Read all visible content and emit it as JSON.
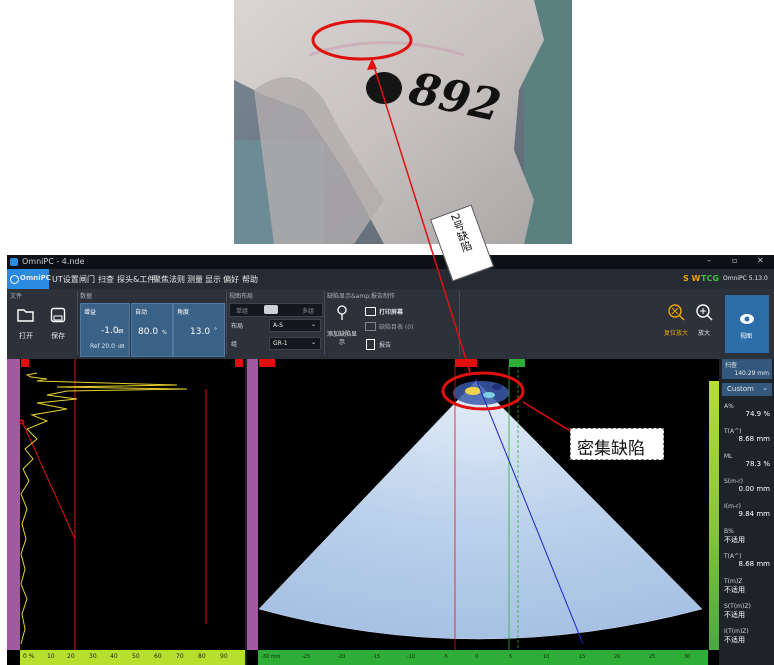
{
  "annotations": {
    "label1": "2号缺陷",
    "label2": "密集缺陷"
  },
  "photo": {
    "number": "892"
  },
  "titlebar": {
    "title": "OmniPC - 4.nde"
  },
  "menu": {
    "brand": "OmniPC",
    "items": [
      "UT设置",
      "闸门",
      "扫查",
      "探头&工件",
      "聚焦法则",
      "测量",
      "显示",
      "偏好",
      "帮助"
    ],
    "sw": "S W",
    "tcg": "TCG",
    "version": "OmniPC 5.13.0"
  },
  "ribbon": {
    "file_group": "文件",
    "open": "打开",
    "save": "保存",
    "data_group": "数据",
    "gain_label": "增益",
    "gain_value": "-1.0",
    "gain_unit": "dB",
    "ref_text": "Ref 20.0",
    "ref_unit": "dB",
    "auto_label": "自动",
    "auto_value": "80.0",
    "auto_unit": "%",
    "angle_label": "角度",
    "angle_value": "13.0",
    "angle_unit": "°",
    "layout_group": "视图布局",
    "single": "单组",
    "multi": "多组",
    "mode_label": "布局",
    "mode_value": "A-S",
    "group_label": "组",
    "group_value": "GR-1",
    "defect_group": "缺陷显示&amp;报告制作",
    "print": "打印屏幕",
    "defect_table": "缺陷目表 (0)",
    "add_defect": "添加缺陷显示",
    "report": "报告",
    "reset_zoom": "复位放大",
    "zoom": "放大",
    "view": "视图"
  },
  "ascan": {
    "x_ticks": [
      "0 %",
      "10",
      "20",
      "30",
      "40",
      "50",
      "60",
      "70",
      "80",
      "90"
    ]
  },
  "sscan": {
    "x_ticks": [
      "-30 mm",
      "-25",
      "-20",
      "-15",
      "-10",
      "-5",
      "0",
      "5",
      "10",
      "15",
      "20",
      "25",
      "30"
    ]
  },
  "readings": {
    "scan_label": "扫查",
    "scan_value": "140.29 mm",
    "mode": "Custom",
    "rows": [
      {
        "name": "A%",
        "value": "74.9 %"
      },
      {
        "name": "T(A^)",
        "value": "8.68 mm"
      },
      {
        "name": "ML",
        "value": "78.3 %"
      },
      {
        "name": "S(m-r)",
        "value": "0.00 mm"
      },
      {
        "name": "I(m-r)",
        "value": "9.84 mm"
      },
      {
        "name": "B%",
        "value": "不适用"
      },
      {
        "name": "T(A^)",
        "value": "8.68 mm"
      },
      {
        "name": "T(m)Z",
        "value": "不适用"
      },
      {
        "name": "S(T(m)Z)",
        "value": "不适用"
      },
      {
        "name": "I(T(m)Z)",
        "value": "不适用"
      }
    ]
  },
  "colors": {
    "accent": "#2b8be0",
    "menu_orange": "#f0a500",
    "menu_green": "#3ac13a",
    "annotation_red": "#e01010"
  }
}
